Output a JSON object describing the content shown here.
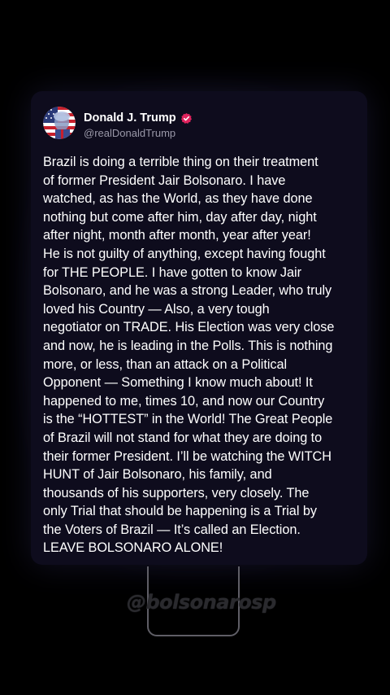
{
  "post": {
    "author_name": "Donald J. Trump",
    "author_handle": "@realDonaldTrump",
    "avatar_icon": "flag-portrait-avatar-icon",
    "verified_icon": "verified-badge-icon",
    "verified_color": "#e0245e",
    "text": "Brazil is doing a terrible thing on their treatment\nof former President Jair Bolsonaro. I have\nwatched, as has the World, as they have done\nnothing but come after him, day after day, night\nafter night, month after month, year after year!\nHe is not guilty of anything, except having fought\nfor THE PEOPLE. I have gotten to know Jair\nBolsonaro, and he was a strong Leader, who truly\nloved his Country — Also, a very tough\nnegotiator on TRADE. His Election was very close\nand now, he is leading in the Polls. This is nothing\nmore, or less, than an attack on a Political\nOpponent — Something I know much about! It\nhappened to me, times 10, and now our Country\nis the “HOTTEST” in the World! The Great People\nof Brazil will not stand for what they are doing to\ntheir former President. I’ll be watching the WITCH\nHUNT of Jair Bolsonaro, his family, and\nthousands of his supporters, very closely. The\nonly Trial that should be happening is a Trial by\nthe Voters of Brazil — It’s called an Election.\nLEAVE BOLSONARO ALONE!"
  },
  "watermark": {
    "text": "@bolsonarosp"
  },
  "colors": {
    "background": "#000000",
    "card": "#0e0c1d",
    "text": "#ffffff",
    "handle": "#9a98a8"
  }
}
